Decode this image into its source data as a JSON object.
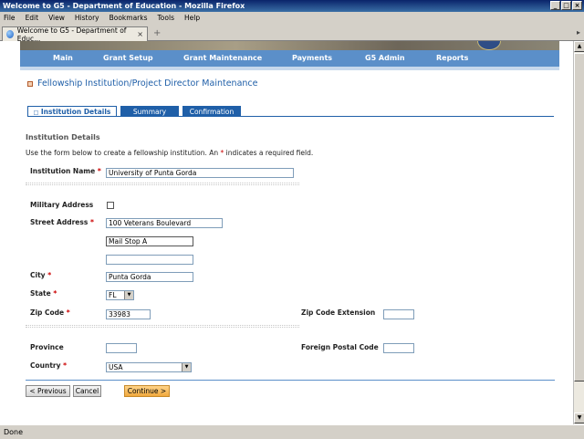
{
  "window": {
    "title": "Welcome to G5 - Department of Education - Mozilla Firefox",
    "min": "_",
    "max": "□",
    "close": "×"
  },
  "menu": [
    "File",
    "Edit",
    "View",
    "History",
    "Bookmarks",
    "Tools",
    "Help"
  ],
  "browser_tab": {
    "label": "Welcome to G5 - Department of Educ...",
    "close": "×"
  },
  "status": "Done",
  "nav": [
    "Main",
    "Grant Setup",
    "Grant Maintenance",
    "Payments",
    "G5 Admin",
    "Reports"
  ],
  "page": {
    "heading": "Fellowship Institution/Project Director Maintenance",
    "steps": [
      "Institution Details",
      "Summary",
      "Confirmation"
    ],
    "section_title": "Institution Details",
    "instructions_before": "Use the form below to create a fellowship institution. An ",
    "instructions_star": "*",
    "instructions_after": " indicates a required field."
  },
  "form": {
    "institution_name": {
      "label": "Institution Name",
      "value": "University of Punta Gorda"
    },
    "military_address": {
      "label": "Military Address",
      "checked": false
    },
    "street_address": {
      "label": "Street Address",
      "line1": "100 Veterans Boulevard",
      "line2": "Mail Stop A",
      "line3": ""
    },
    "city": {
      "label": "City",
      "value": "Punta Gorda"
    },
    "state": {
      "label": "State",
      "value": "FL"
    },
    "zip_code": {
      "label": "Zip Code",
      "value": "33983"
    },
    "zip_extension": {
      "label": "Zip Code Extension",
      "value": ""
    },
    "province": {
      "label": "Province",
      "value": ""
    },
    "foreign_postal_code": {
      "label": "Foreign Postal Code",
      "value": ""
    },
    "country": {
      "label": "Country",
      "value": "USA"
    },
    "required_mark": "*"
  },
  "buttons": {
    "previous": "< Previous",
    "cancel": "Cancel",
    "continue": "Continue >"
  }
}
